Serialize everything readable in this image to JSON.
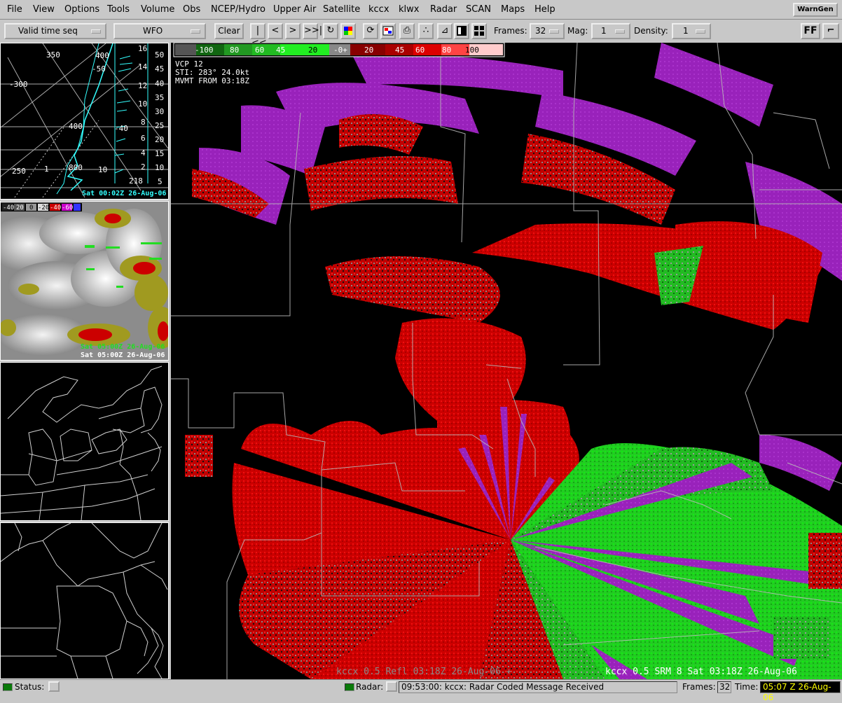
{
  "menubar": {
    "items": [
      "File",
      "View",
      "Options",
      "Tools",
      "Volume",
      "Obs",
      "NCEP/Hydro",
      "Upper Air",
      "Satellite",
      "kccx",
      "klwx",
      "Radar",
      "SCAN",
      "Maps",
      "Help"
    ],
    "warngen_label": "WarnGen"
  },
  "toolbar": {
    "time_mode": "Valid time seq",
    "scale": "WFO",
    "clear_label": "Clear",
    "frames_label": "Frames:",
    "frames_value": "32",
    "mag_label": "Mag:",
    "mag_value": "1",
    "density_label": "Density:",
    "density_value": "1",
    "ff_label": "FF"
  },
  "side_panes": {
    "skewt": {
      "time": "Sat 00:02Z 26-Aug-06",
      "pressure_labels": [
        "350",
        "400",
        "-300",
        "400",
        "250",
        "800",
        "1"
      ],
      "temp_labels": [
        "-50",
        "-40",
        "10"
      ],
      "height_labels": [
        "16",
        "14",
        "12",
        "10",
        "8",
        "6",
        "4",
        "2"
      ],
      "right_labels": [
        "50",
        "45",
        "40",
        "35",
        "30",
        "25",
        "20",
        "15",
        "10",
        "5"
      ],
      "bottom_label": "218"
    },
    "satellite": {
      "legend": [
        "-40",
        "20",
        "0",
        "-20",
        "-40",
        "-60"
      ],
      "time_green": "Sat 05:00Z 26-Aug-06",
      "time_white": "Sat 05:00Z 26-Aug-06"
    }
  },
  "radar": {
    "colorbar_labels": [
      "-100",
      "80",
      "60",
      "45",
      "20",
      "-0+",
      "20",
      "45",
      "60",
      "80",
      "100"
    ],
    "vcp": "VCP 12",
    "sti": "STI: 283°  24.0kt",
    "mvmt": "MVMT FROM 03:18Z",
    "footer_gray": "kccx 0.5 Refl  03:18Z 26-Aug-06 +",
    "footer_white": "kccx 0.5 SRM 8  Sat 03:18Z 26-Aug-06"
  },
  "statusbar": {
    "status_label": "Status:",
    "radar_label": "Radar:",
    "message": "09:53:00: kccx: Radar Coded Message Received",
    "frames_label": "Frames:",
    "frames_value": "32",
    "time_label": "Time:",
    "time_value": "05:07 Z 26-Aug-06"
  },
  "colors": {
    "chrome": "#c8c8c8",
    "inbound_red": "#cc0000",
    "outbound_green": "#22cc22",
    "range_folded_purple": "#9922bb",
    "time_field": "#ffff00"
  }
}
